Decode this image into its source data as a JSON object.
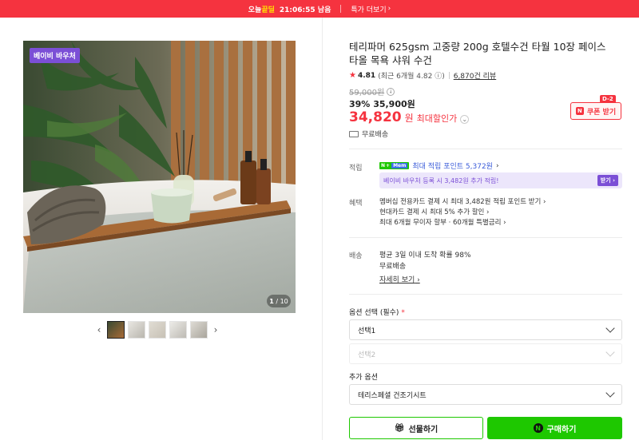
{
  "topbar": {
    "deal_prefix": "오늘",
    "deal_highlight": "끝딜",
    "timer": "21:06:55 남음",
    "more_label": "특가 더보기",
    "bg_color": "#f5333f"
  },
  "gallery": {
    "voucher_badge": "베이비 바우처",
    "counter_current": "1",
    "counter_total": "/ 10",
    "thumb_count": 5
  },
  "product": {
    "title": "테리파머 625gsm 고중량 200g 호텔수건 타월 10장 페이스 타올 목욕 샤워 수건",
    "rating_score": "4.81",
    "rating_recent": "(최근 6개월 4.82",
    "review_count": "6,870건 리뷰",
    "original_price": "59,000원",
    "discount_pct": "39%",
    "discount_price": "35,900원",
    "final_price": "34,820",
    "final_won": "원",
    "max_discount_label": "최대할인가",
    "coupon_label": "쿠폰 받기",
    "coupon_dday": "D-2",
    "free_shipping": "무료배송"
  },
  "points": {
    "label": "적립",
    "badge_n": "N",
    "badge_plus": "+",
    "badge_mem": "Mem",
    "text": "최대 적립 포인트 5,372원",
    "voucher_text": "베이비 바우처 등록 시 3,482원 추가 적립!",
    "voucher_btn": "받기"
  },
  "benefits": {
    "label": "혜택",
    "lines": [
      "멤버십 전용카드 결제 시 최대 3,482원 적립 포인트 받기",
      "현대카드 결제 시 최대 5% 추가 할인",
      "최대 6개월 무이자 할부 · 60개월 특별금리"
    ]
  },
  "delivery": {
    "label": "배송",
    "line1": "평균 3일 이내 도착 확률 98%",
    "line2": "무료배송",
    "detail_link": "자세히 보기"
  },
  "options": {
    "label": "옵션 선택 (필수)",
    "required_mark": "*",
    "select1": "선택1",
    "select2": "선택2",
    "extra_label": "추가 옵션",
    "extra_select": "테리스페셜 건조기시트"
  },
  "actions": {
    "gift": "선물하기",
    "buy": "구매하기",
    "buy_color": "#1ec800"
  }
}
